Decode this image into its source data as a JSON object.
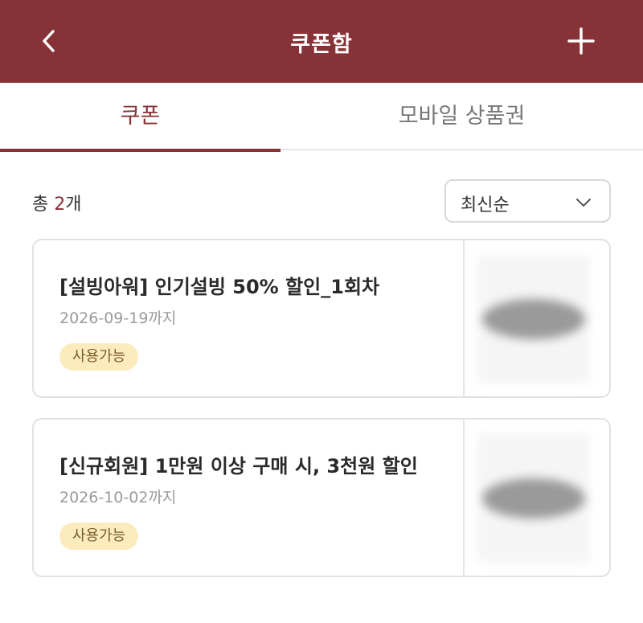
{
  "header": {
    "title": "쿠폰함",
    "back_icon": "chevron-left-icon",
    "add_icon": "plus-icon",
    "color": "#873236"
  },
  "tabs": [
    {
      "label": "쿠폰",
      "active": true
    },
    {
      "label": "모바일 상품권",
      "active": false
    }
  ],
  "summary": {
    "prefix": "총 ",
    "count": "2",
    "suffix": "개"
  },
  "sort": {
    "selected": "최신순",
    "icon": "chevron-down-icon"
  },
  "coupons": [
    {
      "title": "[설빙아워] 인기설빙 50% 할인_1회차",
      "expiry": "2026-09-19까지",
      "status": "사용가능"
    },
    {
      "title": "[신규회원] 1만원 이상 구매 시, 3천원 할인",
      "expiry": "2026-10-02까지",
      "status": "사용가능"
    }
  ]
}
